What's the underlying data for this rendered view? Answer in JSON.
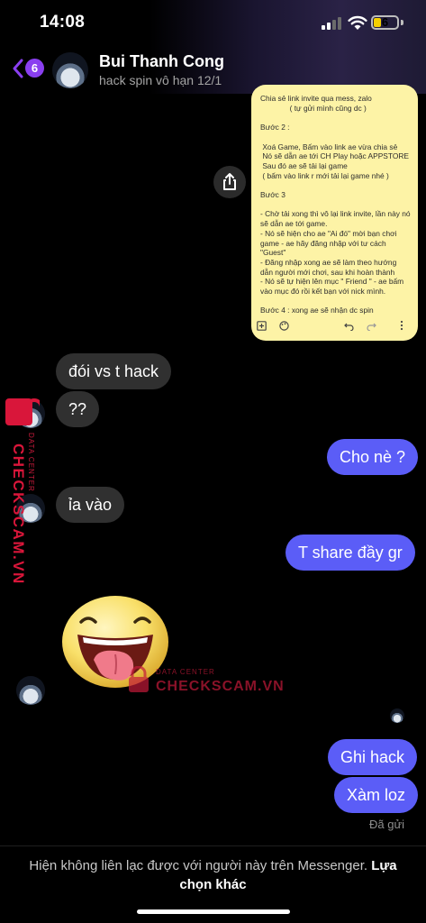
{
  "status_bar": {
    "time": "14:08",
    "battery": "6"
  },
  "header": {
    "back_badge": "6",
    "contact_name": "Bui Thanh Cong",
    "contact_subtitle": "hack spin vô hạn 12/1"
  },
  "note_image": {
    "text": "Chia sẻ link invite qua mess, zalo\n              ( tự gửi mình cũng dc )\n\nBước 2 :\n\n Xoá Game, Bấm vào link ae vừa chia sẻ\n Nó sẽ dẫn ae tới CH Play hoặc APPSTORE\n Sau đó ae sẽ tải lại game\n ( bấm vào link r mới tải lại game nhé )\n\nBước 3\n\n- Chờ tải xong thì vô lại link invite, lần này nó\nsẽ dẫn ae tới game.\n- Nó sẽ hiện cho ae \"Ai đó\" mời bạn chơi\ngame - ae hãy đăng nhập với tư cách\n\"Guest\"\n- Đăng nhập xong ae sẽ làm theo hướng\ndẫn người mới chơi, sau khi hoàn thành\n- Nó sẽ tự hiện lên mục \" Friend \" - ae bấm\nvào mục đó rồi kết bạn với nick mình.\n\nBước 4 : xong ae sẽ nhận dc spin"
  },
  "messages": [
    {
      "side": "in",
      "text": "đói vs t hack"
    },
    {
      "side": "in",
      "text": "??"
    },
    {
      "side": "out",
      "text": "Cho nè ?"
    },
    {
      "side": "in",
      "text": "ỉa vào"
    },
    {
      "side": "out",
      "text": "T share đầy gr"
    },
    {
      "side": "out",
      "text": "Ghi hack"
    },
    {
      "side": "out",
      "text": "Xàm loz"
    }
  ],
  "seen_label": "Đã gửi",
  "footer": {
    "text": "Hiện không liên lạc được với người này trên Messenger.",
    "link": "Lựa chọn khác"
  },
  "watermark": {
    "brand": "CHECKSCAM.VN",
    "tag": "DATA CENTER"
  },
  "icons": [
    "back-chevron-icon",
    "share-icon",
    "add-box-icon",
    "palette-icon",
    "undo-icon",
    "redo-icon",
    "more-icon",
    "lock-icon"
  ],
  "colors": {
    "accent": "#8a3ff0",
    "outgoing_bubble": "#5b5df7",
    "incoming_bubble": "#303030",
    "note_bg": "#fdf3a6",
    "watermark": "#d9163a"
  }
}
